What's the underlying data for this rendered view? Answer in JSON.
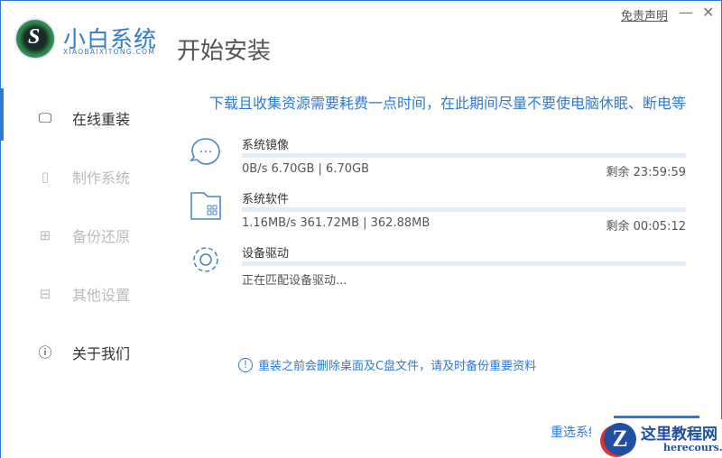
{
  "app": {
    "brand": "小白系统",
    "brand_sub": "XIAOBAIXITONG.COM",
    "title": "开始安装",
    "disclaimer": "免责声明",
    "minimize": "—",
    "close": "✕"
  },
  "sidebar": {
    "items": [
      {
        "label": "在线重装",
        "icon": "monitor-icon"
      },
      {
        "label": "制作系统",
        "icon": "usb-icon"
      },
      {
        "label": "备份还原",
        "icon": "grid-icon"
      },
      {
        "label": "其他设置",
        "icon": "briefcase-icon"
      },
      {
        "label": "关于我们",
        "icon": "info-icon"
      }
    ]
  },
  "main": {
    "notice": "下载且收集资源需要耗费一点时间，在此期间尽量不要使电脑休眠、断电等",
    "tasks": [
      {
        "name": "系统镜像",
        "stat": "0B/s 6.70GB | 6.70GB",
        "remain": "剩余 23:59:59",
        "progress": 0
      },
      {
        "name": "系统软件",
        "stat": "1.16MB/s 361.72MB | 362.88MB",
        "remain": "剩余 00:05:12",
        "progress": 0
      },
      {
        "name": "设备驱动",
        "stat": "正在匹配设备驱动...",
        "remain": "",
        "progress": 0
      }
    ],
    "warning": "重装之前会删除桌面及C盘文件，请及时备份重要资料",
    "reselect": "重选系统"
  },
  "watermark": {
    "title": "这里教程网",
    "url": "herecours.com"
  }
}
